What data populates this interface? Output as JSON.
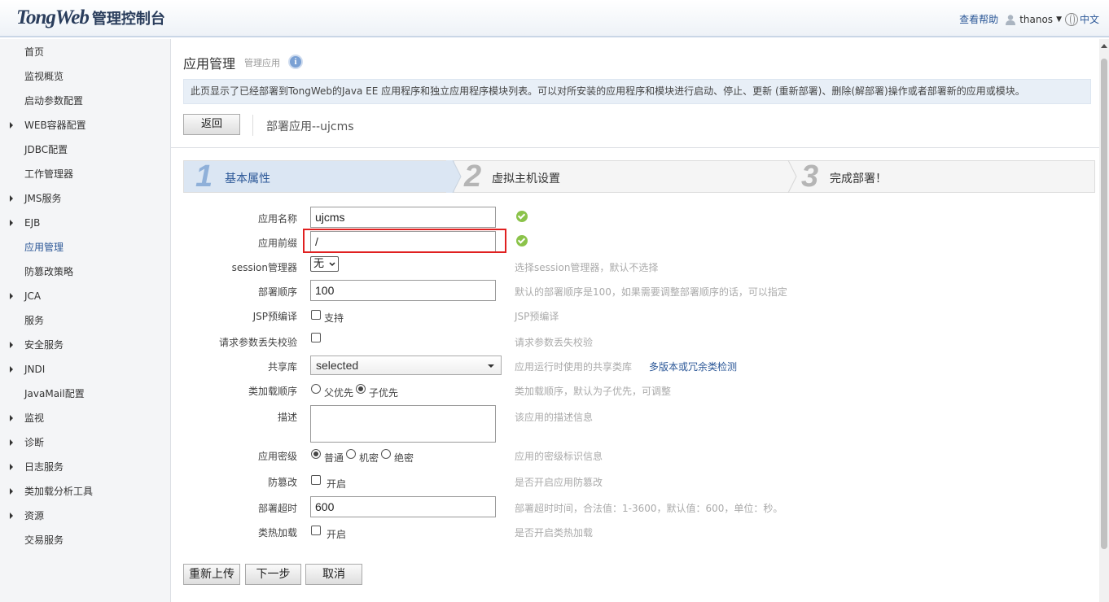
{
  "header": {
    "brand": "TongWeb",
    "console": "管理控制台",
    "help": "查看帮助",
    "user": "thanos",
    "language": "中文"
  },
  "sidebar": {
    "items": [
      {
        "label": "首页",
        "expandable": false
      },
      {
        "label": "监视概览",
        "expandable": false
      },
      {
        "label": "启动参数配置",
        "expandable": false
      },
      {
        "label": "WEB容器配置",
        "expandable": true
      },
      {
        "label": "JDBC配置",
        "expandable": false
      },
      {
        "label": "工作管理器",
        "expandable": false
      },
      {
        "label": "JMS服务",
        "expandable": true
      },
      {
        "label": "EJB",
        "expandable": true
      },
      {
        "label": "应用管理",
        "expandable": false,
        "active": true
      },
      {
        "label": "防篡改策略",
        "expandable": false
      },
      {
        "label": "JCA",
        "expandable": true
      },
      {
        "label": "服务",
        "expandable": false
      },
      {
        "label": "安全服务",
        "expandable": true
      },
      {
        "label": "JNDI",
        "expandable": true
      },
      {
        "label": "JavaMail配置",
        "expandable": false
      },
      {
        "label": "监视",
        "expandable": true
      },
      {
        "label": "诊断",
        "expandable": true
      },
      {
        "label": "日志服务",
        "expandable": true
      },
      {
        "label": "类加载分析工具",
        "expandable": true
      },
      {
        "label": "资源",
        "expandable": true
      },
      {
        "label": "交易服务",
        "expandable": false
      }
    ]
  },
  "main": {
    "title": "应用管理",
    "subtitle": "管理应用",
    "description": "此页显示了已经部署到TongWeb的Java EE 应用程序和独立应用程序模块列表。可以对所安装的应用程序和模块进行启动、停止、更新 (重新部署)、删除(解部署)操作或者部署新的应用或模块。",
    "back_label": "返回",
    "deploy_label": "部署应用--ujcms",
    "steps": [
      {
        "num": "1",
        "label": "基本属性"
      },
      {
        "num": "2",
        "label": "虚拟主机设置"
      },
      {
        "num": "3",
        "label": "完成部署！"
      }
    ]
  },
  "form": {
    "app_name": {
      "label": "应用名称",
      "value": "ujcms"
    },
    "app_prefix": {
      "label": "应用前缀",
      "value": "/"
    },
    "session_manager": {
      "label": "session管理器",
      "value": "无",
      "hint": "选择session管理器，默认不选择"
    },
    "deploy_order": {
      "label": "部署顺序",
      "value": "100",
      "hint": "默认的部署顺序是100，如果需要调整部署顺序的话，可以指定"
    },
    "jsp_precompile": {
      "label": "JSP预编译",
      "option": "支持",
      "hint": "JSP预编译"
    },
    "param_check": {
      "label": "请求参数丢失校验",
      "hint": "请求参数丢失校验"
    },
    "shared_lib": {
      "label": "共享库",
      "value": "selected",
      "hint": "应用运行时使用的共享类库",
      "link": "多版本或冗余类检测"
    },
    "class_load_order": {
      "label": "类加载顺序",
      "option_parent": "父优先",
      "option_child": "子优先",
      "hint": "类加载顺序，默认为子优先，可调整"
    },
    "description": {
      "label": "描述",
      "hint": "该应用的描述信息"
    },
    "security_level": {
      "label": "应用密级",
      "option_normal": "普通",
      "option_secret": "机密",
      "option_top": "绝密",
      "hint": "应用的密级标识信息"
    },
    "tamper": {
      "label": "防篡改",
      "option": "开启",
      "hint": "是否开启应用防篡改"
    },
    "deploy_timeout": {
      "label": "部署超时",
      "value": "600",
      "hint": "部署超时时间，合法值：1-3600，默认值：600，单位：秒。"
    },
    "hot_load": {
      "label": "类热加载",
      "option": "开启",
      "hint": "是否开启类热加载"
    }
  },
  "buttons": {
    "reupload": "重新上传",
    "next": "下一步",
    "cancel": "取消"
  }
}
